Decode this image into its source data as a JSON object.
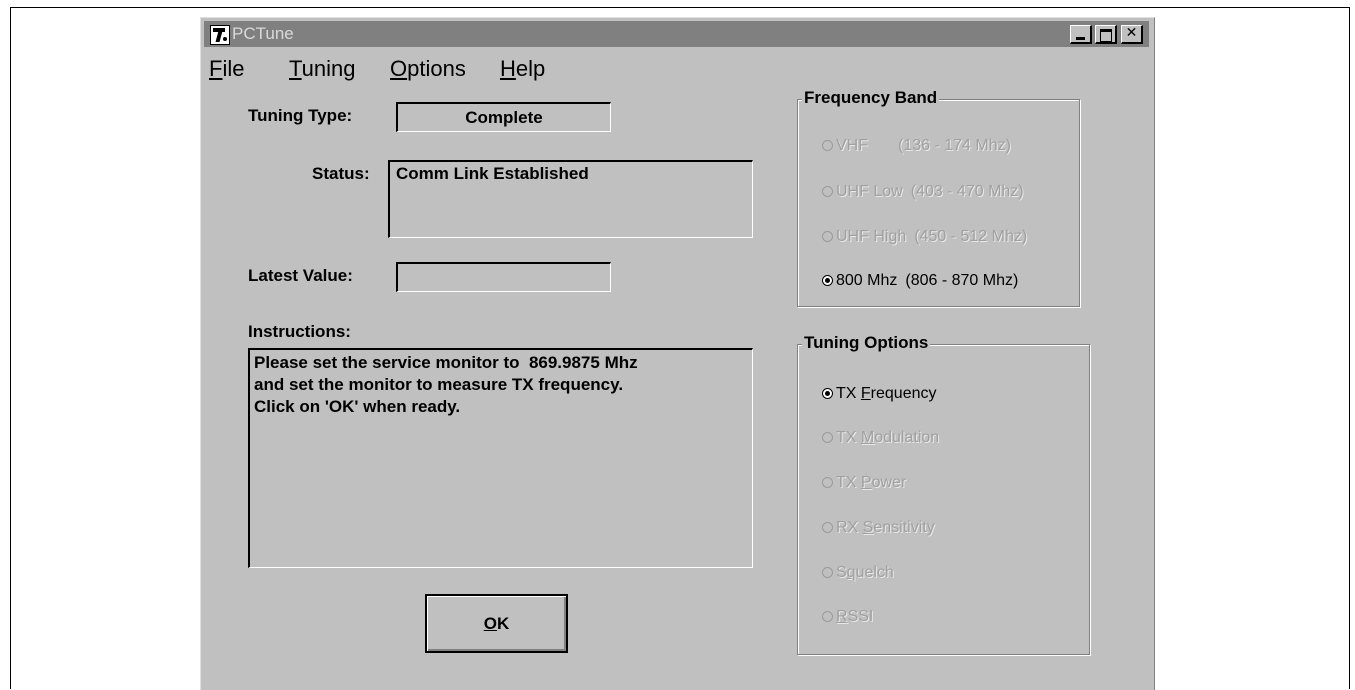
{
  "window": {
    "title": "PCTune"
  },
  "menu": {
    "file": {
      "mnemonic": "F",
      "rest": "ile"
    },
    "tuning": {
      "mnemonic": "T",
      "rest": "uning"
    },
    "options": {
      "mnemonic": "O",
      "rest": "ptions"
    },
    "help": {
      "mnemonic": "H",
      "rest": "elp"
    }
  },
  "form": {
    "tuning_type_label": "Tuning Type:",
    "tuning_type_value": "Complete",
    "status_label": "Status:",
    "status_value": "Comm Link Established",
    "latest_value_label": "Latest Value:",
    "latest_value": "",
    "instructions_label": "Instructions:",
    "instructions_text": "Please set the service monitor to  869.9875 Mhz\nand set the monitor to measure TX frequency.\nClick on 'OK' when ready."
  },
  "ok_button": {
    "mnemonic": "O",
    "rest": "K"
  },
  "frequency_band": {
    "title": "Frequency Band",
    "options": [
      {
        "label": "VHF",
        "range": "(136 - 174 Mhz)",
        "selected": false,
        "enabled": false
      },
      {
        "label": "UHF Low",
        "range": "(403 - 470 Mhz)",
        "selected": false,
        "enabled": false
      },
      {
        "label": "UHF High",
        "range": "(450 - 512 Mhz)",
        "selected": false,
        "enabled": false
      },
      {
        "label": "800 Mhz",
        "range": "(806 - 870 Mhz)",
        "selected": true,
        "enabled": true
      }
    ]
  },
  "tuning_options": {
    "title": "Tuning Options",
    "options": [
      {
        "prefix": "TX ",
        "mnemonic": "F",
        "rest": "requency",
        "selected": true,
        "enabled": true
      },
      {
        "prefix": "TX ",
        "mnemonic": "M",
        "rest": "odulation",
        "selected": false,
        "enabled": false
      },
      {
        "prefix": "TX ",
        "mnemonic": "P",
        "rest": "ower",
        "selected": false,
        "enabled": false
      },
      {
        "prefix": "RX ",
        "mnemonic": "S",
        "rest": "ensitivity",
        "selected": false,
        "enabled": false
      },
      {
        "prefix": "S",
        "mnemonic": "q",
        "rest": "uelch",
        "selected": false,
        "enabled": false
      },
      {
        "prefix": "",
        "mnemonic": "R",
        "rest": "SSI",
        "selected": false,
        "enabled": false
      }
    ]
  }
}
